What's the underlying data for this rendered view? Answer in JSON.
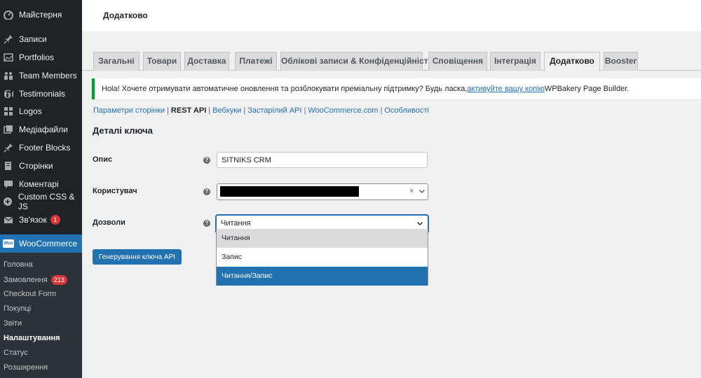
{
  "sidebar": {
    "items": [
      {
        "label": "Майстерня",
        "icon": "dashboard-icon"
      },
      {
        "label": "Записи",
        "icon": "pin-icon"
      },
      {
        "label": "Portfolios",
        "icon": "portfolio-icon"
      },
      {
        "label": "Team Members",
        "icon": "team-icon"
      },
      {
        "label": "Testimonials",
        "icon": "quote-icon"
      },
      {
        "label": "Logos",
        "icon": "grid-icon"
      },
      {
        "label": "Медіафайли",
        "icon": "media-icon"
      },
      {
        "label": "Footer Blocks",
        "icon": "pin-icon"
      },
      {
        "label": "Сторінки",
        "icon": "page-icon"
      },
      {
        "label": "Коментарі",
        "icon": "comment-icon"
      },
      {
        "label": "Custom CSS & JS",
        "icon": "plus-circle-icon"
      },
      {
        "label": "Зв'язок",
        "icon": "mail-icon",
        "badge": "1"
      }
    ],
    "woocommerce": {
      "label": "WooCommerce",
      "logo": "Woo"
    },
    "submenu": [
      {
        "label": "Головна"
      },
      {
        "label": "Замовлення",
        "badge": "213"
      },
      {
        "label": "Checkout Form"
      },
      {
        "label": "Покупці"
      },
      {
        "label": "Звіти"
      },
      {
        "label": "Налаштування",
        "current": true
      },
      {
        "label": "Статус"
      },
      {
        "label": "Розширення"
      }
    ]
  },
  "header": {
    "title": "Додатково"
  },
  "tabs": [
    {
      "label": "Загальні"
    },
    {
      "label": "Товари"
    },
    {
      "label": "Доставка"
    },
    {
      "label": "Платежі"
    },
    {
      "label": "Облікові записи & Конфіденційність"
    },
    {
      "label": "Сповіщення"
    },
    {
      "label": "Інтеграція"
    },
    {
      "label": "Додатково",
      "active": true
    },
    {
      "label": "Booster"
    }
  ],
  "notice": {
    "before": "Hola! Хочете отримувати автоматичне оновлення та розблокувати преміальну підтримку? Будь ласка, ",
    "link": "активуйте вашу копію",
    "after": " WPBakery Page Builder."
  },
  "subnav": {
    "items": [
      {
        "label": "Параметри сторінки"
      },
      {
        "label": "REST API",
        "current": true
      },
      {
        "label": "Вебхуки"
      },
      {
        "label": "Застарілий API"
      },
      {
        "label": "WooCommerce.com"
      },
      {
        "label": "Особливості"
      }
    ],
    "separator": "|"
  },
  "form": {
    "section_title": "Деталі ключа",
    "help_glyph": "?",
    "description": {
      "label": "Опис",
      "value": "SITNIKS CRM"
    },
    "user": {
      "label": "Користувач",
      "clear_glyph": "×"
    },
    "permissions": {
      "label": "Дозволи",
      "value": "Читання",
      "options": [
        "Читання",
        "Запис",
        "Читання/Запис"
      ],
      "hovered_index": 0,
      "selected_index": 2
    },
    "generate_button": "Генерування ключа API"
  },
  "colors": {
    "accent": "#2271b1",
    "sidebar_bg": "#1d2327",
    "notice_border": "#00a32a",
    "badge": "#d63638"
  }
}
